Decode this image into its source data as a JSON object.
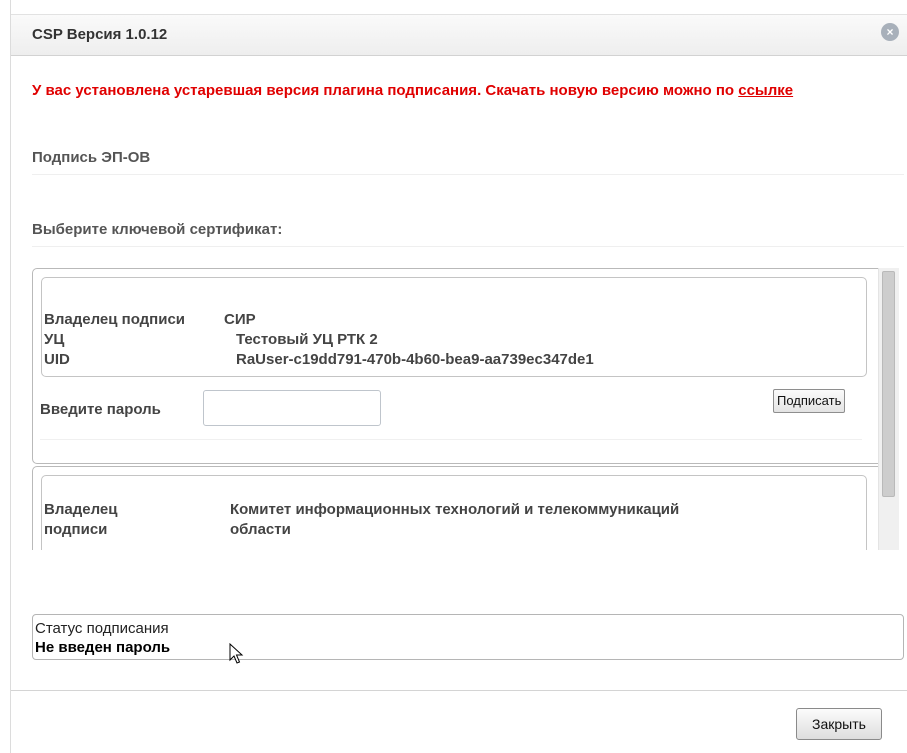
{
  "dialog": {
    "title": "CSP Версия 1.0.12",
    "close_icon_glyph": "×"
  },
  "warning": {
    "text": "У вас установлена устаревшая версия плагина подписания. Скачать новую версию можно по ",
    "link_text": "ссылке",
    "color": "#e00000"
  },
  "signature_title": "Подпись ЭП-ОВ",
  "select_cert_label": "Выберите ключевой сертификат:",
  "certificates": [
    {
      "owner_label": "Владелец подписи",
      "owner_value": "СИР",
      "ca_label": "УЦ",
      "ca_value": "Тестовый УЦ РТК 2",
      "uid_label": "UID",
      "uid_value": "RaUser-c19dd791-470b-4b60-bea9-aa739ec347de1",
      "password_label": "Введите пароль",
      "password_value": "",
      "sign_button": "Подписать"
    },
    {
      "owner_label_line1": "Владелец",
      "owner_label_line2": "подписи",
      "owner_value_line1": "Комитет информационных технологий и телекоммуникаций",
      "owner_value_line2": "области"
    }
  ],
  "status": {
    "label": "Статус подписания",
    "value": "Не введен пароль"
  },
  "footer": {
    "close_button": "Закрыть"
  }
}
